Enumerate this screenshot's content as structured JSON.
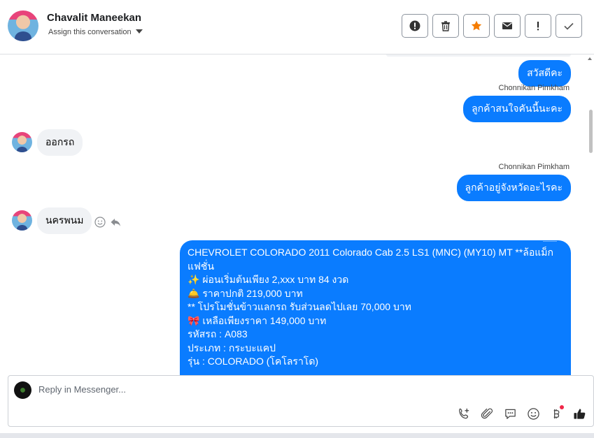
{
  "header": {
    "contact_name": "Chavalit Maneekan",
    "assign_label": "Assign this conversation",
    "actions": [
      {
        "name": "mark-spam-button",
        "icon": "alert-circle-icon"
      },
      {
        "name": "delete-button",
        "icon": "trash-icon"
      },
      {
        "name": "star-button",
        "icon": "star-icon"
      },
      {
        "name": "mark-unread-button",
        "icon": "envelope-icon"
      },
      {
        "name": "follow-up-button",
        "icon": "exclamation-icon"
      },
      {
        "name": "mark-done-button",
        "icon": "checkmark-icon"
      }
    ]
  },
  "messages": {
    "m1": "สวัสดีคะ",
    "m2_sender": "Chonnikan Pimkham",
    "m2": "ลูกค้าสนใจคันนี้นะคะ",
    "m3": "ออกรถ",
    "m4_sender": "Chonnikan Pimkham",
    "m4": "ลูกค้าอยู่จังหวัดอะไรคะ",
    "m5": "นครพนม",
    "long": {
      "l1": "CHEVROLET COLORADO 2011 Colorado Cab 2.5 LS1 (MNC) (MY10) MT **ล้อแม็ก",
      "l2": "แฟชั่น",
      "l3": "✨ ผ่อนเริ่มต้นเพียง 2,xxx บาท 84 งวด",
      "l4": "🛎️ ราคาปกติ 219,000 บาท",
      "l5": "** โปรโมชั่นข้าวแลกรถ รับส่วนลดไปเลย 70,000 บาท",
      "l6": "🎀 เหลือเพียงราคา 149,000 บาท",
      "l7": "รหัสรถ : A083",
      "l8": "ประเภท : กระบะแคป",
      "l9": "รุ่น : COLORADO (โคโลราโด)"
    }
  },
  "composer": {
    "placeholder": "Reply in Messenger...",
    "tools": [
      "phone-add-icon",
      "paperclip-icon",
      "saved-replies-icon",
      "emoji-icon",
      "bitcoin-icon",
      "like-icon"
    ]
  },
  "colors": {
    "outgoing_bubble": "#0a7cff",
    "incoming_bubble": "#f0f2f5",
    "star": "#f57c00"
  }
}
